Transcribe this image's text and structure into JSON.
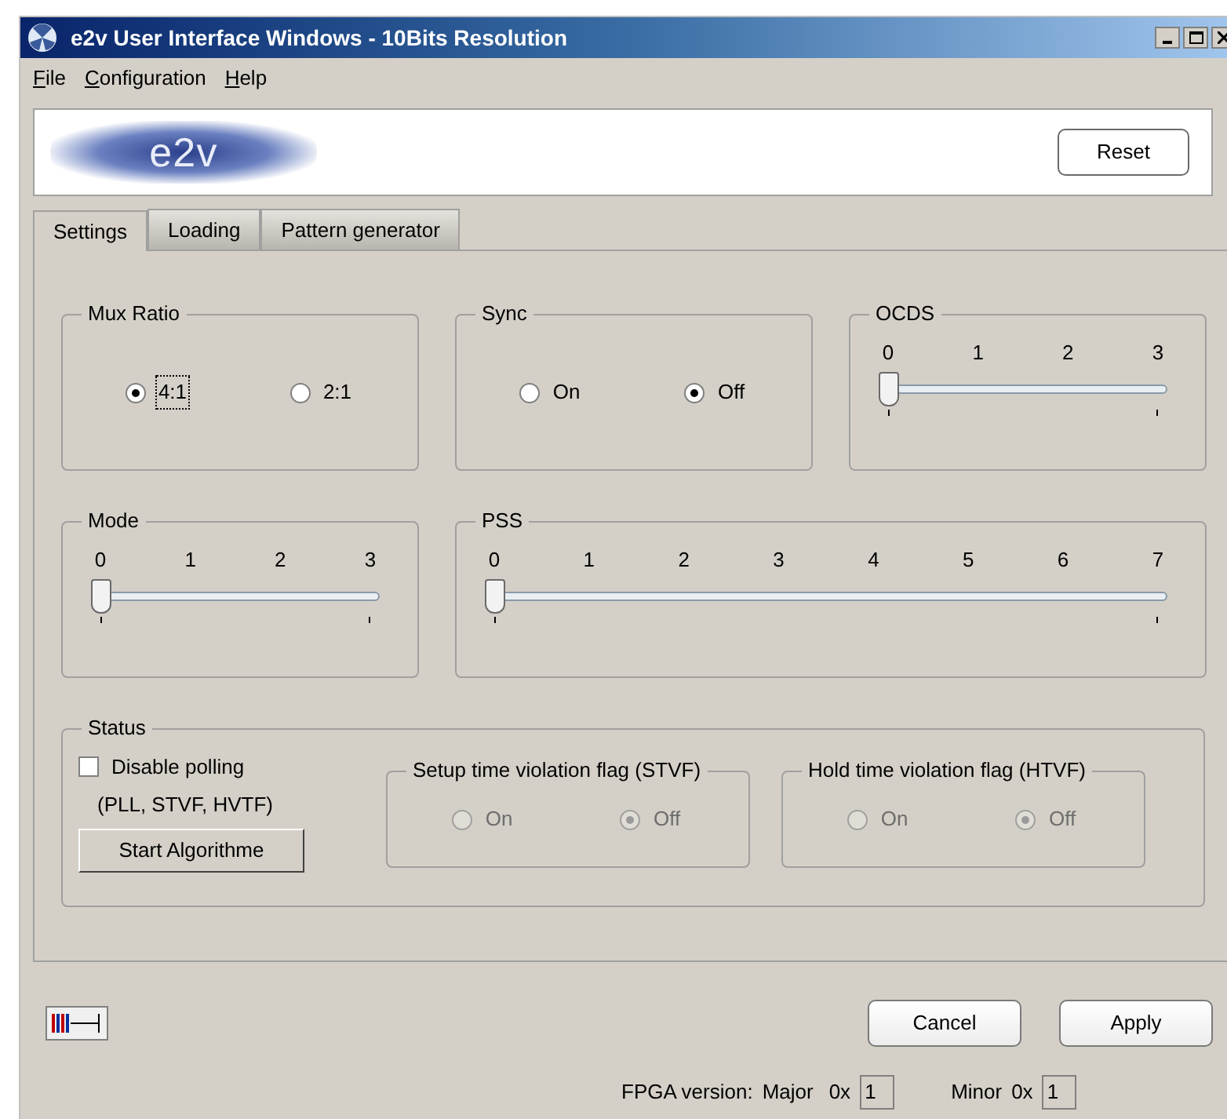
{
  "window": {
    "title": "e2v User Interface Windows - 10Bits Resolution"
  },
  "menu": [
    {
      "label": "File"
    },
    {
      "label": "Configuration"
    },
    {
      "label": "Help"
    }
  ],
  "banner": {
    "logo": "e2v",
    "reset_button": "Reset"
  },
  "tabs": [
    {
      "label": "Settings",
      "selected": true
    },
    {
      "label": "Loading",
      "selected": false
    },
    {
      "label": "Pattern generator",
      "selected": false
    }
  ],
  "group_rows": [
    [
      {
        "kind": "radio",
        "title": "Mux Ratio",
        "options": [
          {
            "label": "4:1",
            "selected": true,
            "focused": true
          },
          {
            "label": "2:1",
            "selected": false,
            "focused": false
          }
        ]
      },
      {
        "kind": "radio",
        "title": "Sync",
        "options": [
          {
            "label": "On",
            "selected": false
          },
          {
            "label": "Off",
            "selected": true
          }
        ]
      },
      {
        "kind": "slider",
        "title": "OCDS",
        "ticks": [
          "0",
          "1",
          "2",
          "3"
        ],
        "level": 0
      }
    ],
    [
      {
        "kind": "slider",
        "title": "Mode",
        "ticks": [
          "0",
          "1",
          "2",
          "3"
        ],
        "level": 0
      },
      {
        "kind": "slider",
        "title": "PSS",
        "ticks": [
          "0",
          "1",
          "2",
          "3",
          "4",
          "5",
          "6",
          "7"
        ],
        "level": 0
      }
    ]
  ],
  "status": {
    "title": "Status",
    "disable_polling": {
      "label": "Disable polling",
      "checked": false
    },
    "note": "(PLL, STVF, HVTF)",
    "start_button": "Start Algorithme",
    "flags": [
      {
        "title": "Setup time violation flag (STVF)",
        "disabled": true,
        "options": [
          {
            "label": "On",
            "selected": false
          },
          {
            "label": "Off",
            "selected": true
          }
        ]
      },
      {
        "title": "Hold time violation flag  (HTVF)",
        "disabled": true,
        "options": [
          {
            "label": "On",
            "selected": false
          },
          {
            "label": "Off",
            "selected": true
          }
        ]
      }
    ]
  },
  "footer": {
    "buttons": [
      "Cancel",
      "Apply"
    ]
  },
  "fpga": {
    "label": "FPGA version:",
    "major_label": "Major",
    "major_prefix": "0x",
    "major_value": "1",
    "minor_label": "Minor",
    "minor_prefix": "0x",
    "minor_value": "1"
  }
}
